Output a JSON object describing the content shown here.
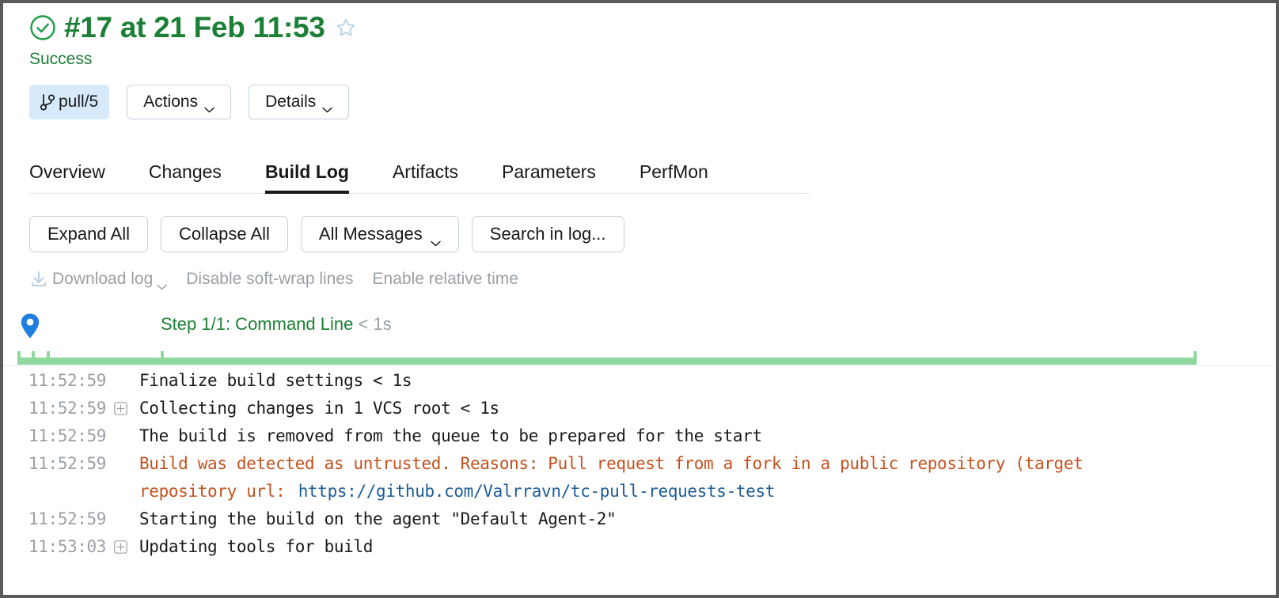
{
  "header": {
    "status_icon": "check-circle-icon",
    "title": "#17 at 21 Feb 11:53",
    "favorite_icon": "star-outline-icon",
    "status_text": "Success",
    "status_color": "#1b7f35"
  },
  "actions": {
    "branch": {
      "icon": "branch-icon",
      "label": "pull/5",
      "bg": "#d6eaf9"
    },
    "buttons": [
      {
        "label": "Actions",
        "icon": "chevron-down-icon"
      },
      {
        "label": "Details",
        "icon": "chevron-down-icon"
      }
    ]
  },
  "tabs": [
    {
      "label": "Overview",
      "active": false
    },
    {
      "label": "Changes",
      "active": false
    },
    {
      "label": "Build Log",
      "active": true
    },
    {
      "label": "Artifacts",
      "active": false
    },
    {
      "label": "Parameters",
      "active": false
    },
    {
      "label": "PerfMon",
      "active": false
    }
  ],
  "log_toolbar": [
    {
      "label": "Expand All",
      "icon": null
    },
    {
      "label": "Collapse All",
      "icon": null
    },
    {
      "label": "All Messages",
      "icon": "chevron-down-icon"
    },
    {
      "label": "Search in log...",
      "icon": null
    }
  ],
  "log_links": [
    {
      "label": "Download log",
      "icon": "download-icon",
      "chevron": "chevron-down-icon"
    },
    {
      "label": "Disable soft-wrap lines",
      "icon": null,
      "chevron": null
    },
    {
      "label": "Enable relative time",
      "icon": null,
      "chevron": null
    }
  ],
  "step": {
    "marker_icon": "map-pin-icon",
    "label": "Step 1/1: Command Line",
    "duration": "< 1s",
    "color": "#1b7f35"
  },
  "timeline": {
    "color": "#8fd99f"
  },
  "log_lines": [
    {
      "time": "11:52:59",
      "expandable": false,
      "text": "Finalize build settings < 1s",
      "type": "normal"
    },
    {
      "time": "11:52:59",
      "expandable": true,
      "text": "Collecting changes in 1 VCS root < 1s",
      "type": "normal"
    },
    {
      "time": "11:52:59",
      "expandable": false,
      "text": "The build is removed from the queue to be prepared for the start",
      "type": "normal"
    },
    {
      "time": "11:52:59",
      "expandable": false,
      "text": "Build was detected as untrusted. Reasons: Pull request from a fork in a public repository (target",
      "type": "warning",
      "continuation_prefix": "repository url: ",
      "continuation_link": "https://github.com/Valrravn/tc-pull-requests-test"
    },
    {
      "time": "11:52:59",
      "expandable": false,
      "text": "Starting the build on the agent \"Default Agent-2\"",
      "type": "normal"
    },
    {
      "time": "11:53:03",
      "expandable": true,
      "text": "Updating tools for build",
      "type": "normal"
    }
  ]
}
